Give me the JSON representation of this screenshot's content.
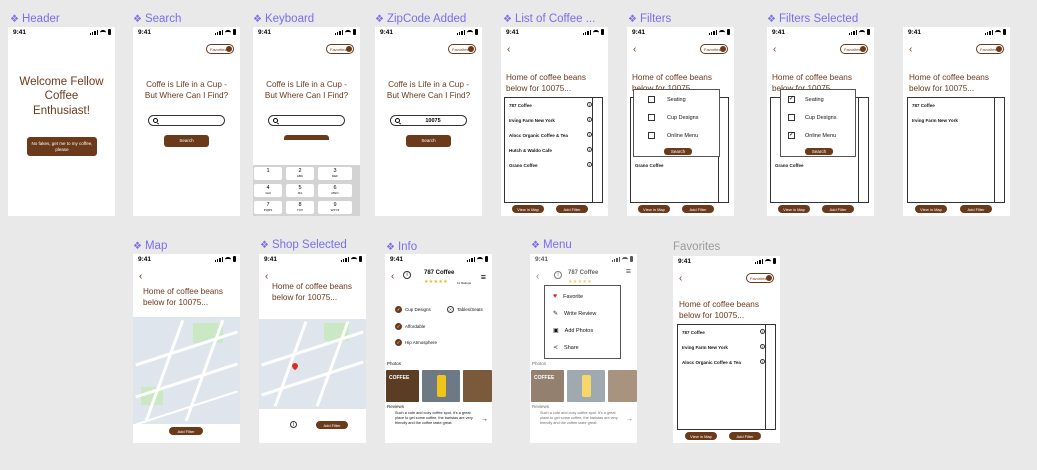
{
  "labels": [
    "Header",
    "Search",
    "Keyboard",
    "ZipCode Added",
    "List of Coffee ...",
    "Filters",
    "Filters Selected",
    "Map",
    "Shop Selected",
    "Info",
    "Menu",
    "Favorites"
  ],
  "status_time": "9:41",
  "favorites_pill": "Favorites",
  "header": {
    "welcome": "Welcome Fellow Coffee Enthusiast!",
    "cta": "No fakes, get me to my coffee, please"
  },
  "search": {
    "question": "Coffe is Life in a Cup - But Where Can I Find?",
    "button": "Search",
    "zip_value": "10075"
  },
  "keypad": [
    {
      "n": "1",
      "l": ""
    },
    {
      "n": "2",
      "l": "ABC"
    },
    {
      "n": "3",
      "l": "DEF"
    },
    {
      "n": "4",
      "l": "GHI"
    },
    {
      "n": "5",
      "l": "JKL"
    },
    {
      "n": "6",
      "l": "MNO"
    },
    {
      "n": "7",
      "l": "PQRS"
    },
    {
      "n": "8",
      "l": "TUV"
    },
    {
      "n": "9",
      "l": "WXYZ"
    },
    {
      "n": "0",
      "l": ""
    }
  ],
  "list": {
    "title": "Home of coffee beans below for 10075...",
    "items": [
      "787 Coffee",
      "Irving Farm New York",
      "Alocc Organic Coffee & Tea",
      "Hutch & Waldo Cafe",
      "Grano Coffee"
    ],
    "view_map": "View in Map",
    "add_filter": "Add Filter"
  },
  "filters": {
    "options": [
      "Seating",
      "Cup Designs",
      "Online Menu"
    ],
    "search": "Search"
  },
  "info": {
    "shop": "787 Coffee",
    "reviews_count": "11 Ratings",
    "features": [
      "Cup Designs",
      "Affordable",
      "Hip Atmosphere"
    ],
    "missing": "Tables/Seats",
    "photos_label": "Photos",
    "reviews_label": "Reviews",
    "review_text": "Such a cute and cozy coffee spot. It's a great place to get some coffee, the baristas are very friendly and the coffee taste great.",
    "photo_text": "COFFEE"
  },
  "menu": {
    "items": [
      "Favorite",
      "Write Review",
      "Add Photos",
      "Share"
    ]
  },
  "favorites": {
    "items": [
      "787 Coffee",
      "Irving Farm New York",
      "Alocc Organic Coffee & Tea"
    ]
  },
  "list_short": {
    "title": "Home of coffee beans below for 10075...",
    "items": [
      "787 Coffee",
      "Irving Farm New York"
    ]
  }
}
